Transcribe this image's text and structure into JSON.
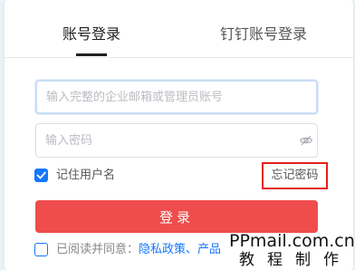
{
  "tabs": [
    {
      "label": "账号登录",
      "active": true
    },
    {
      "label": "钉钉账号登录",
      "active": false
    }
  ],
  "form": {
    "email_placeholder": "输入完整的企业邮箱或管理员账号",
    "password_placeholder": "输入密码",
    "remember_label": "记住用户名",
    "remember_checked": true,
    "forgot_label": "忘记密码",
    "login_label": "登录",
    "agree_prefix": "已阅读并同意：",
    "agree_links": "隐私政策、产品",
    "agree_checked": false
  },
  "watermark": {
    "line1": "PPmail.com.cn",
    "line2": "教程制作"
  },
  "colors": {
    "accent": "#1677ff",
    "login_button": "#ef4d4d",
    "highlight_box": "#e2211c"
  },
  "icons": {
    "password_toggle": "eye-slash-icon",
    "remember_checkbox": "check-icon"
  }
}
